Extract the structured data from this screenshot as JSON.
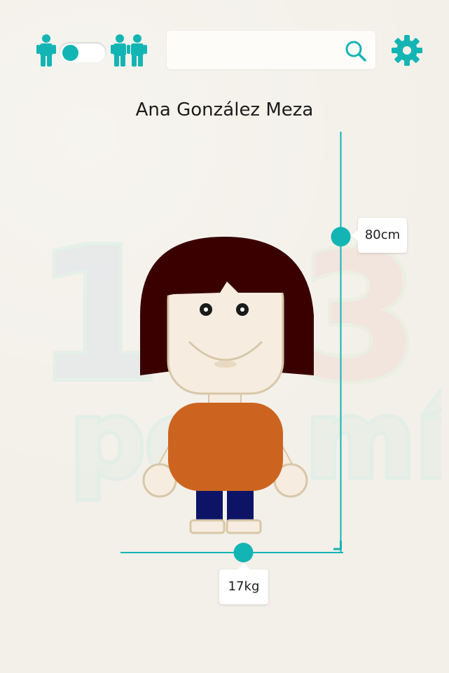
{
  "header": {
    "mode_toggle": {
      "state": "off",
      "left_icon": "single-child-icon",
      "right_icon": "two-children-icon"
    },
    "search": {
      "value": "",
      "placeholder": "",
      "icon": "search-icon"
    },
    "settings_icon": "gear-icon"
  },
  "child": {
    "name": "Ana González Meza"
  },
  "watermark": {
    "text_numbers": "123",
    "text_word": "por mí"
  },
  "measurements": {
    "height_label": "80cm",
    "weight_label": "17kg"
  },
  "colors": {
    "accent": "#13b5b4",
    "background": "#f3f0e9",
    "hair": "#3a0000",
    "shirt": "#cc6420",
    "pants": "#0d1466",
    "skin": "#f6ece0",
    "skin_outline": "#d8c7a8"
  }
}
